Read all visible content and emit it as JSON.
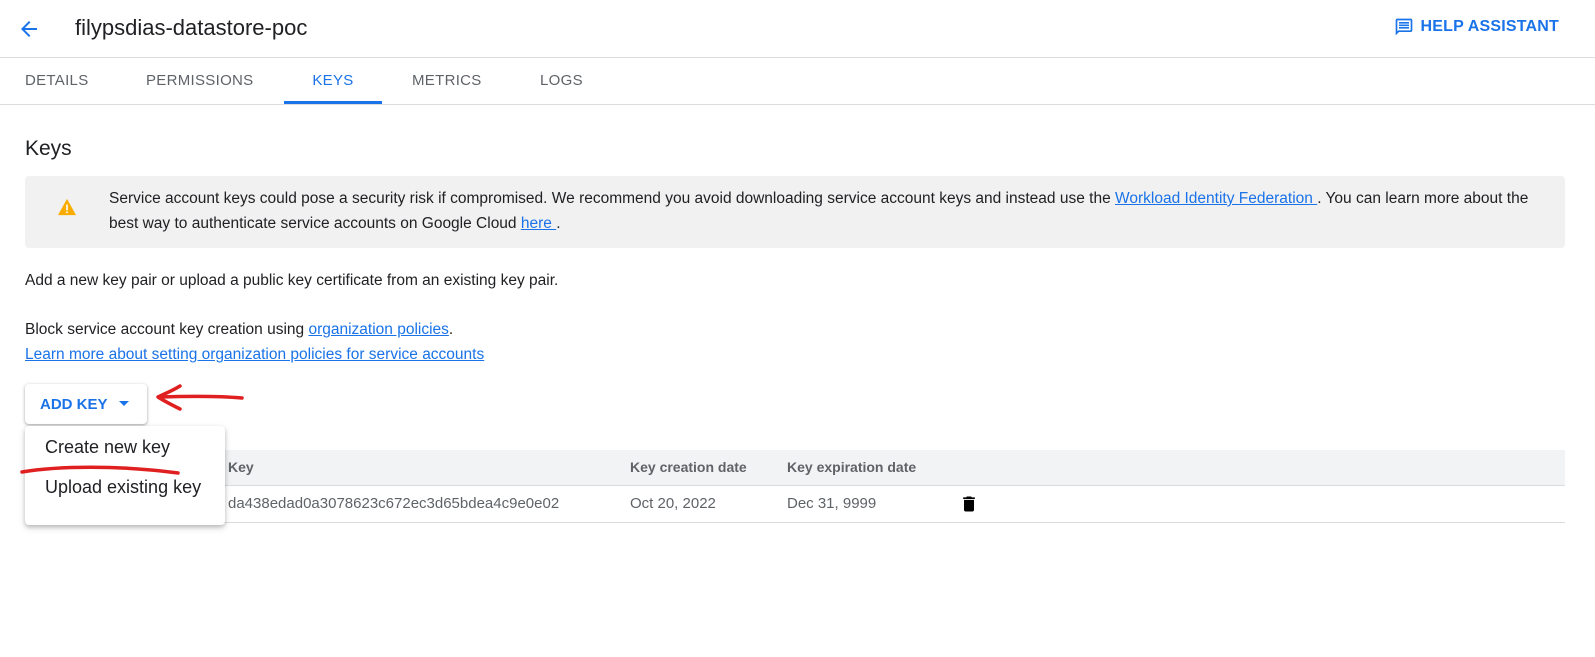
{
  "header": {
    "title": "filypsdias-datastore-poc",
    "help_label": "HELP ASSISTANT",
    "back_icon": "arrow-back-icon",
    "help_icon": "feedback-icon"
  },
  "tabs": [
    {
      "label": "DETAILS",
      "active": false
    },
    {
      "label": "PERMISSIONS",
      "active": false
    },
    {
      "label": "KEYS",
      "active": true
    },
    {
      "label": "METRICS",
      "active": false
    },
    {
      "label": "LOGS",
      "active": false
    }
  ],
  "main": {
    "section_title": "Keys",
    "warning": {
      "icon": "warning-icon",
      "text_before": "Service account keys could pose a security risk if compromised. We recommend you avoid downloading service account keys and instead use the ",
      "link1": "Workload Identity Federation ",
      "text_middle": ". You can learn more about the best way to authenticate service accounts on Google Cloud ",
      "link2": "here ",
      "text_after": "."
    },
    "intro_text": "Add a new key pair or upload a public key certificate from an existing key pair.",
    "block_text_before": "Block service account key creation using ",
    "block_link": "organization policies",
    "block_text_after": ".",
    "learn_more_link": "Learn more about setting organization policies for service accounts",
    "add_key_label": "ADD KEY",
    "add_key_icon": "arrow-drop-down-icon"
  },
  "dropdown_menu": {
    "items": [
      "Create new key",
      "Upload existing key"
    ]
  },
  "keys_table": {
    "columns": [
      "Key",
      "Key creation date",
      "Key expiration date"
    ],
    "rows": [
      {
        "key": "da438edad0a3078623c672ec3d65bdea4c9e0e02",
        "created": "Oct 20, 2022",
        "expires": "Dec 31, 9999",
        "action_icon": "delete-icon"
      }
    ]
  },
  "colors": {
    "accent": "#1a73e8",
    "warning": "#f9ab00",
    "annotation": "#e02020"
  }
}
